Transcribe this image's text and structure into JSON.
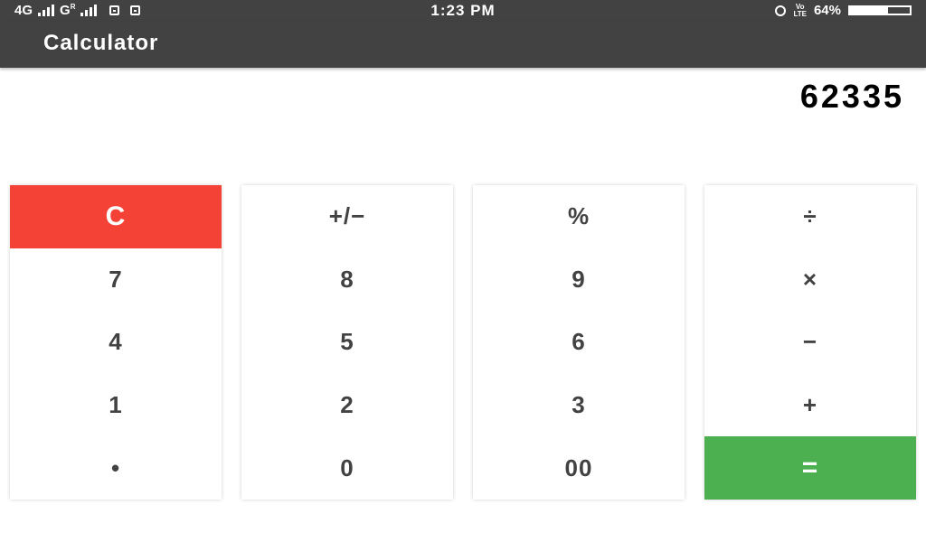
{
  "status_bar": {
    "network1": "4G",
    "network2": "G",
    "network2_sup": "R",
    "time": "1:23 PM",
    "volte_line1": "Vo",
    "volte_line2": "LTE",
    "battery_text": "64%",
    "battery_level": 0.64
  },
  "app_bar": {
    "title": "Calculator"
  },
  "display": {
    "value": "62335"
  },
  "keypad": {
    "columns": [
      [
        "C",
        "7",
        "4",
        "1",
        "•"
      ],
      [
        "+/−",
        "8",
        "5",
        "2",
        "0"
      ],
      [
        "%",
        "9",
        "6",
        "3",
        "00"
      ],
      [
        "÷",
        "×",
        "−",
        "+",
        "="
      ]
    ]
  },
  "colors": {
    "toolbar": "#424242",
    "clear_key": "#f44336",
    "equals_key": "#4caf50",
    "key_text": "#424242"
  },
  "icons": {
    "signal": "signal-bars-icon",
    "sim": "sim-card-icon",
    "alarm": "alarm-clock-icon",
    "battery": "battery-icon"
  }
}
